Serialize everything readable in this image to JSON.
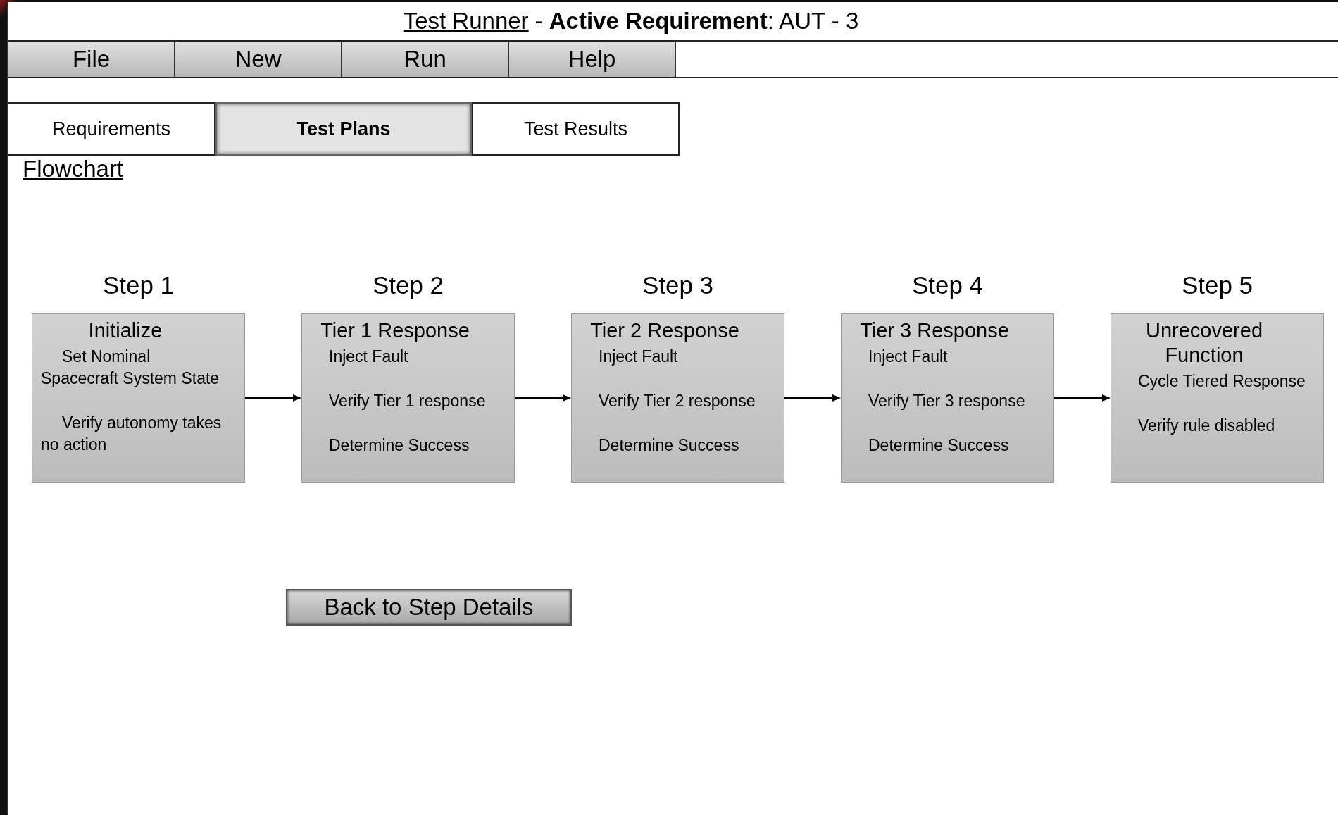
{
  "window": {
    "app_name": "Test Runner",
    "title": "- **Active Requirement**: AUT - 3"
  },
  "menu": [
    "File",
    "New",
    "Run",
    "Help"
  ],
  "tabs": [
    {
      "label": "Requirements",
      "selected": false
    },
    {
      "label": "Test Plans",
      "selected": true
    },
    {
      "label": "Test Results",
      "selected": false
    }
  ],
  "section_link": "Flowchart",
  "steps": [
    {
      "label": "Step 1",
      "title": "Initialize",
      "kind": "indented",
      "paragraphs": [
        [
          "Set Nominal",
          "Spacecraft System State"
        ],
        [
          "Verify autonomy takes",
          "no action"
        ]
      ]
    },
    {
      "label": "Step 2",
      "title": "Tier 1 Response",
      "kind": "plain",
      "paragraphs": [
        [
          "Inject Fault"
        ],
        [
          "Verify Tier 1 response"
        ],
        [
          "Determine Success"
        ]
      ]
    },
    {
      "label": "Step 3",
      "title": "Tier 2 Response",
      "kind": "plain",
      "paragraphs": [
        [
          "Inject Fault"
        ],
        [
          "Verify Tier 2 response"
        ],
        [
          "Determine Success"
        ]
      ]
    },
    {
      "label": "Step 4",
      "title": "Tier 3 Response",
      "kind": "plain",
      "paragraphs": [
        [
          "Inject Fault"
        ],
        [
          "Verify Tier 3 response"
        ],
        [
          "Determine Success"
        ]
      ]
    },
    {
      "label": "Step 5",
      "title": "Unrecovered Function",
      "kind": "plain",
      "paragraphs": [
        [
          "Cycle Tiered Response"
        ],
        [
          "Verify rule disabled"
        ]
      ]
    }
  ],
  "back_button": "Back to Step Details"
}
